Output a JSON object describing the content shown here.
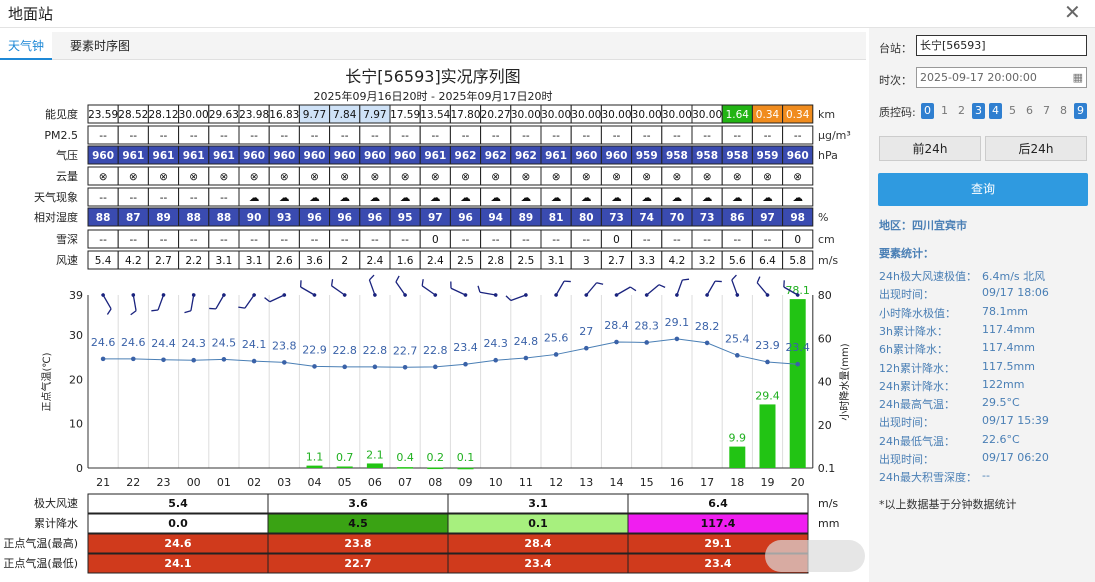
{
  "window": {
    "title": "地面站",
    "close_icon": "close-icon"
  },
  "tabs": [
    {
      "label": "天气钟",
      "active": true
    },
    {
      "label": "要素时序图",
      "active": false
    }
  ],
  "chart_title": "长宁[56593]实况序列图",
  "chart_subtitle": "2025年09月16日20时 - 2025年09月17日20时",
  "hours": [
    "21",
    "22",
    "23",
    "00",
    "01",
    "02",
    "03",
    "04",
    "05",
    "06",
    "07",
    "08",
    "09",
    "10",
    "11",
    "12",
    "13",
    "14",
    "15",
    "16",
    "17",
    "18",
    "19",
    "20"
  ],
  "rows": [
    {
      "label": "能见度",
      "unit": "km",
      "values": [
        "23.59",
        "28.52",
        "28.12",
        "30.00",
        "29.63",
        "23.98",
        "16.83",
        "9.77",
        "7.84",
        "7.97",
        "17.59",
        "13.54",
        "17.80",
        "20.27",
        "30.00",
        "30.00",
        "30.00",
        "30.00",
        "30.00",
        "30.00",
        "30.00",
        "1.64",
        "0.34",
        "0.34"
      ],
      "colors": [
        "#fff",
        "#fff",
        "#fff",
        "#fff",
        "#fff",
        "#fff",
        "#fff",
        "#cfe2f7",
        "#cfe2f7",
        "#cfe2f7",
        "#fff",
        "#fff",
        "#fff",
        "#fff",
        "#fff",
        "#fff",
        "#fff",
        "#fff",
        "#fff",
        "#fff",
        "#fff",
        "#22b414",
        "#f08c1e",
        "#f08c1e"
      ]
    },
    {
      "label": "PM2.5",
      "unit": "μg/m³",
      "values": [
        "--",
        "--",
        "--",
        "--",
        "--",
        "--",
        "--",
        "--",
        "--",
        "--",
        "--",
        "--",
        "--",
        "--",
        "--",
        "--",
        "--",
        "--",
        "--",
        "--",
        "--",
        "--",
        "--",
        "--"
      ]
    },
    {
      "label": "气压",
      "unit": "hPa",
      "values": [
        "960",
        "961",
        "961",
        "961",
        "961",
        "960",
        "960",
        "960",
        "960",
        "960",
        "960",
        "961",
        "962",
        "962",
        "962",
        "961",
        "960",
        "960",
        "959",
        "958",
        "958",
        "958",
        "959",
        "960"
      ],
      "fill": "#3a4bb0"
    },
    {
      "label": "云量",
      "unit": "",
      "values": [
        "⊗",
        "⊗",
        "⊗",
        "⊗",
        "⊗",
        "⊗",
        "⊗",
        "⊗",
        "⊗",
        "⊗",
        "⊗",
        "⊗",
        "⊗",
        "⊗",
        "⊗",
        "⊗",
        "⊗",
        "⊗",
        "⊗",
        "⊗",
        "⊗",
        "⊗",
        "⊗",
        "⊗"
      ]
    },
    {
      "label": "天气现象",
      "unit": "",
      "values": [
        "--",
        "--",
        "--",
        "--",
        "--",
        "☁",
        "☁",
        "☁",
        "☁",
        "☁",
        "☁",
        "☁",
        "☁",
        "☁",
        "☁",
        "☁",
        "☁",
        "☁",
        "☁",
        "☁",
        "☁",
        "☁",
        "☁",
        "☁"
      ]
    },
    {
      "label": "相对湿度",
      "unit": "%",
      "values": [
        "88",
        "87",
        "89",
        "88",
        "88",
        "90",
        "93",
        "96",
        "96",
        "96",
        "95",
        "97",
        "96",
        "94",
        "89",
        "81",
        "80",
        "73",
        "74",
        "70",
        "73",
        "86",
        "97",
        "98"
      ],
      "fill": "#3a4bb0"
    },
    {
      "label": "雪深",
      "unit": "cm",
      "values": [
        "--",
        "--",
        "--",
        "--",
        "--",
        "--",
        "--",
        "--",
        "--",
        "--",
        "--",
        "0",
        "--",
        "--",
        "--",
        "--",
        "--",
        "0",
        "--",
        "--",
        "--",
        "--",
        "--",
        "0"
      ]
    },
    {
      "label": "风速",
      "unit": "m/s",
      "values": [
        "5.4",
        "4.2",
        "2.7",
        "2.2",
        "3.1",
        "3.1",
        "2.6",
        "3.6",
        "2",
        "2.4",
        "1.6",
        "2.4",
        "2.5",
        "2.8",
        "2.5",
        "3.1",
        "3",
        "2.7",
        "3.3",
        "4.2",
        "3.2",
        "5.6",
        "6.4",
        "5.8"
      ]
    }
  ],
  "chart_data": {
    "type": "line",
    "x": [
      "21",
      "22",
      "23",
      "00",
      "01",
      "02",
      "03",
      "04",
      "05",
      "06",
      "07",
      "08",
      "09",
      "10",
      "11",
      "12",
      "13",
      "14",
      "15",
      "16",
      "17",
      "18",
      "19",
      "20"
    ],
    "series": [
      {
        "name": "正点气温",
        "values": [
          24.6,
          24.6,
          24.4,
          24.3,
          24.5,
          24.1,
          23.8,
          22.9,
          22.8,
          22.8,
          22.7,
          22.8,
          23.4,
          24.3,
          24.8,
          25.6,
          27,
          28.4,
          28.3,
          29.1,
          28.2,
          25.4,
          23.9,
          23.4
        ]
      },
      {
        "name": "小时降水量",
        "values": [
          null,
          null,
          null,
          null,
          null,
          null,
          null,
          1.1,
          0.7,
          2.1,
          0.4,
          0.2,
          0.1,
          null,
          null,
          null,
          null,
          null,
          null,
          null,
          null,
          9.9,
          29.4,
          78.1
        ]
      }
    ],
    "ylabel_left": "正点气温(℃)",
    "ylabel_right": "小时降水量(mm)",
    "yticks_left": [
      "0",
      "10",
      "20",
      "30",
      "39"
    ],
    "yticks_right": [
      "0.1",
      "20",
      "40",
      "60",
      "80"
    ],
    "ylim_left": [
      0,
      39
    ],
    "ylim_right": [
      0,
      80
    ]
  },
  "summary": {
    "labels": [
      "极大风速",
      "累计降水",
      "正点气温(最高)",
      "正点气温(最低)"
    ],
    "units": [
      "m/s",
      "mm",
      "",
      ""
    ],
    "wind": [
      "5.4",
      "3.6",
      "3.1",
      "6.4"
    ],
    "rain": [
      "0.0",
      "4.5",
      "0.1",
      "117.4"
    ],
    "rain_colors": [
      "#ffffff",
      "#3aa314",
      "#a7f07e",
      "#f01ef0"
    ],
    "tmax": [
      "24.6",
      "23.8",
      "28.4",
      "29.1"
    ],
    "tmin": [
      "24.1",
      "22.7",
      "23.4",
      "23.4"
    ],
    "temp_color": "#d03a1c"
  },
  "sidebar": {
    "station_label": "台站：",
    "station_value": "长宁[56593]",
    "time_label": "时次：",
    "time_value": "2025-09-17 20:00:00",
    "qc_label": "质控码:",
    "qc_codes": [
      "0",
      "1",
      "2",
      "3",
      "4",
      "5",
      "6",
      "7",
      "8",
      "9"
    ],
    "qc_selected": [
      "0",
      "3",
      "4",
      "9"
    ],
    "prev_label": "前24h",
    "next_label": "后24h",
    "query_label": "查询",
    "region": "地区：四川宜宾市",
    "stats_title": "要素统计：",
    "stats": [
      {
        "k": "24h极大风速极值：",
        "v": "6.4m/s 北风"
      },
      {
        "k": "出现时间：",
        "v": "09/17 18:06"
      },
      {
        "k": "小时降水极值：",
        "v": "78.1mm"
      },
      {
        "k": "3h累计降水：",
        "v": "117.4mm"
      },
      {
        "k": "6h累计降水：",
        "v": "117.4mm"
      },
      {
        "k": "12h累计降水：",
        "v": "117.5mm"
      },
      {
        "k": "24h累计降水：",
        "v": "122mm"
      },
      {
        "k": "24h最高气温：",
        "v": "29.5°C"
      },
      {
        "k": "出现时间：",
        "v": "09/17 15:39"
      },
      {
        "k": "24h最低气温：",
        "v": "22.6°C"
      },
      {
        "k": "出现时间：",
        "v": "09/17 06:20"
      },
      {
        "k": "24h最大积雪深度：",
        "v": "--"
      }
    ],
    "footnote": "*以上数据基于分钟数据统计"
  },
  "colors": {
    "accent": "#1e88d6",
    "line": "#4a7fb5",
    "bar": "#22c414"
  }
}
